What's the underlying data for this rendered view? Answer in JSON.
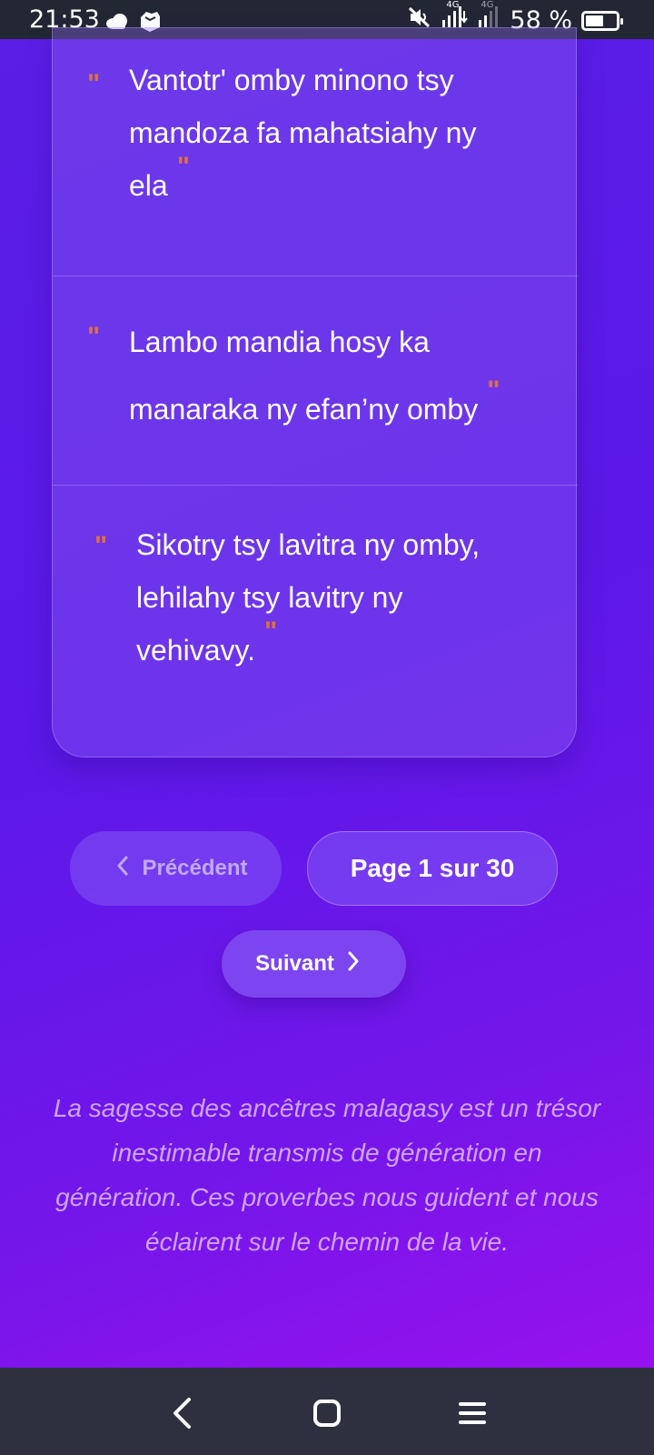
{
  "status_bar": {
    "time": "21:53",
    "battery": "58 %",
    "battery_level": 0.58,
    "network_label_1": "4G",
    "network_label_2": "4G",
    "icons": [
      "cloud-icon",
      "app-notification-icon",
      "mute-icon",
      "signal-icon",
      "signal-icon-2",
      "battery-icon"
    ]
  },
  "proverbs": [
    {
      "text": "Vantotr' omby minono tsy mandoza fa mahatsiahy ny ela"
    },
    {
      "text": "Lambo mandia hosy ka manaraka ny efan’ny omby"
    },
    {
      "text": "Sikotry tsy lavitra ny omby, lehilahy tsy lavitry ny vehivavy."
    }
  ],
  "quote_mark": "\"",
  "pagination": {
    "prev_label": "Précédent",
    "page_label": "Page 1 sur 30",
    "next_label": "Suivant"
  },
  "footer_text": "La sagesse des ancêtres malagasy est un trésor inestimable transmis de génération en génération. Ces proverbes nous guident et nous éclairent sur le chemin de la vie.",
  "nav_bar": {
    "icons": [
      "back-icon",
      "home-icon",
      "menu-icon"
    ]
  },
  "colors": {
    "accent_quote": "#e0703a",
    "background_start": "#5a1ee6",
    "background_end": "#a010ee",
    "next_button": "#7c45ef"
  }
}
